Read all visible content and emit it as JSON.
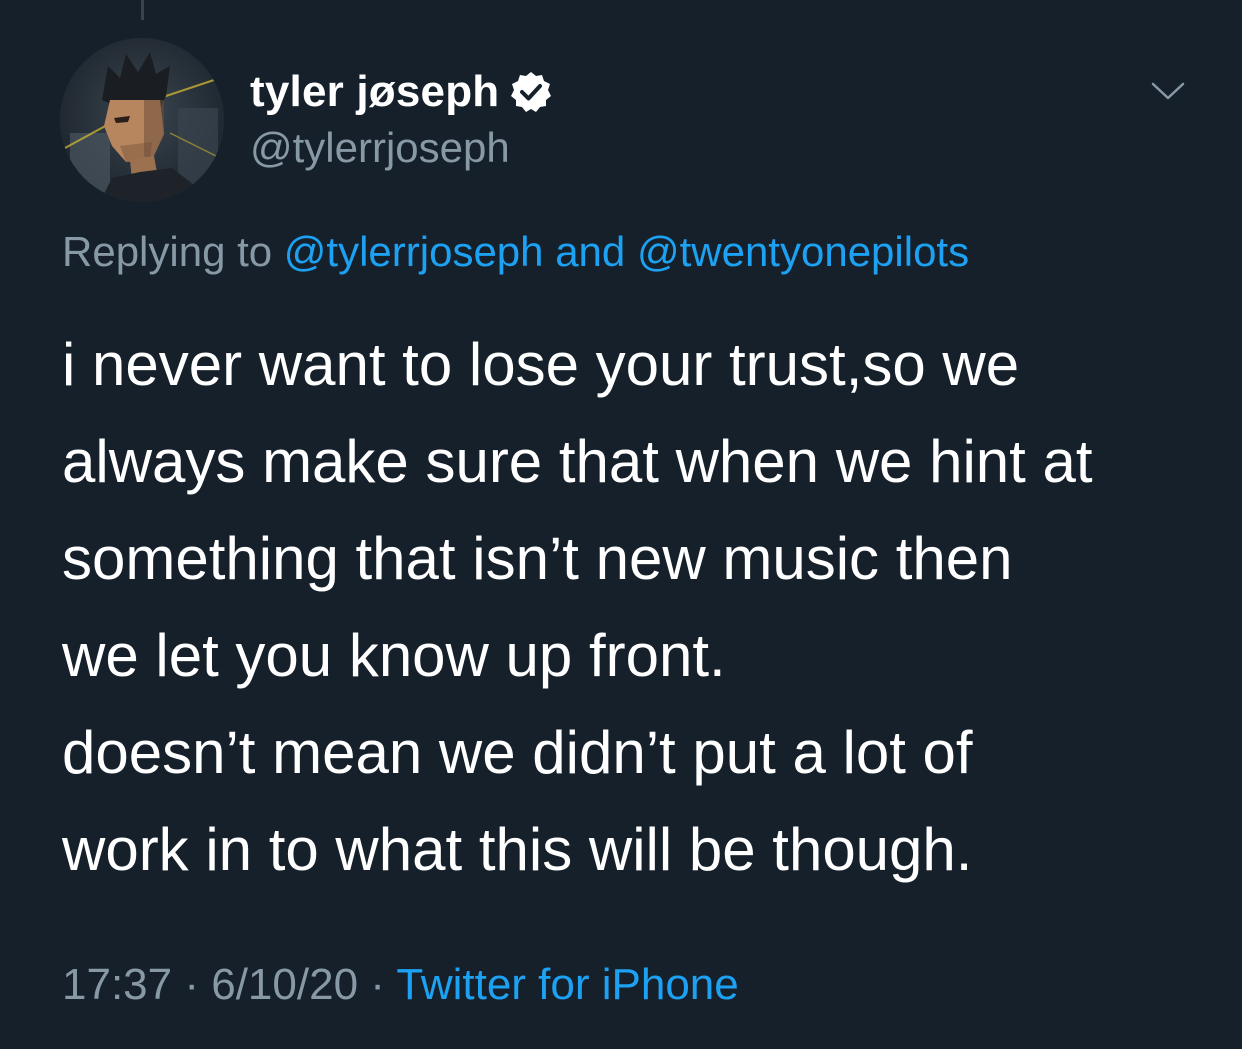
{
  "tweet": {
    "display_name": "tyler jøseph",
    "handle": "@tylerrjoseph",
    "reply_prefix": "Replying to",
    "reply_mention_1": "@tylerrjoseph",
    "reply_and": "and",
    "reply_mention_2": "@twentyonepilots",
    "body_lines": [
      "i never want to lose your trust,so we",
      "always make sure that when we hint at",
      "something that isn’t new music then",
      "we let you know up front.",
      "doesn’t mean we didn’t put a lot of",
      "work in to what this will be though."
    ],
    "time": "17:37",
    "separator": "·",
    "date": "6/10/20",
    "source": "Twitter for iPhone"
  },
  "icons": {
    "verified": "verified-badge-icon",
    "caret": "chevron-down-icon"
  },
  "colors": {
    "background": "#15202b",
    "text_primary": "#ffffff",
    "text_secondary": "#8899a6",
    "accent": "#1da1f2"
  }
}
